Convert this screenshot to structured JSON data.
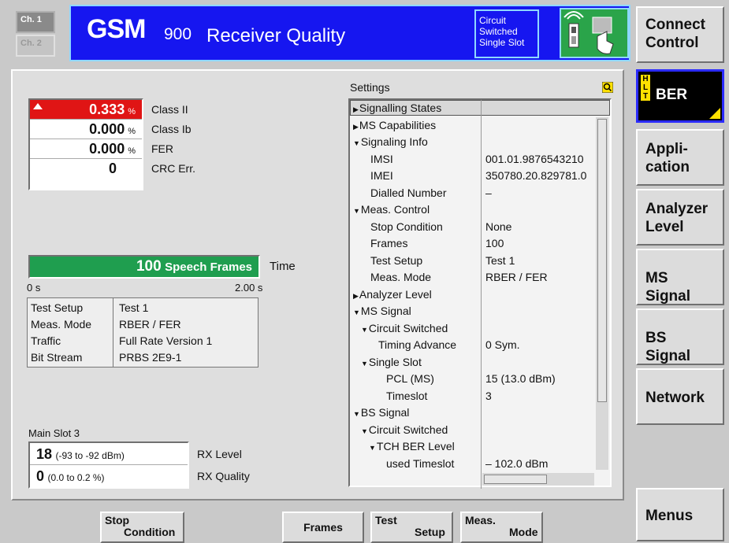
{
  "channels": [
    {
      "label": "Ch. 1",
      "active": true
    },
    {
      "label": "Ch. 2",
      "active": false
    }
  ],
  "title": {
    "gsm": "GSM",
    "band": "900",
    "measurement": "Receiver Quality"
  },
  "mode": {
    "line1": "Circuit",
    "line2": "Switched",
    "line3": "Single Slot"
  },
  "softkeys_right": {
    "connect": {
      "line1": "Connect",
      "line2": "Control"
    },
    "ber": {
      "label": "BER",
      "hlt": "HLT"
    },
    "application": {
      "line1": "Appli-",
      "line2": "cation"
    },
    "analyzer": {
      "line1": "Analyzer",
      "line2": "Level"
    },
    "ms_signal": "MS Signal",
    "bs_signal": "BS Signal",
    "network": "Network",
    "menus": "Menus"
  },
  "results": [
    {
      "value": "0.333",
      "unit": "%",
      "label": "Class II",
      "alarm": true
    },
    {
      "value": "0.000",
      "unit": "%",
      "label": "Class Ib",
      "alarm": false
    },
    {
      "value": "0.000",
      "unit": "%",
      "label": "FER",
      "alarm": false
    },
    {
      "value": "0",
      "unit": "",
      "label": "CRC Err.",
      "alarm": false
    }
  ],
  "progress": {
    "count": "100",
    "unit": "Speech Frames",
    "label": "Time",
    "start": "0 s",
    "end": "2.00 s",
    "fill_fraction": 1.0,
    "bar_color": "#1f9e4f"
  },
  "info": {
    "rows": [
      {
        "key": "Test Setup",
        "value": "Test 1"
      },
      {
        "key": "Meas. Mode",
        "value": "RBER / FER"
      },
      {
        "key": "Traffic",
        "value": "Full Rate Version 1"
      },
      {
        "key": "Bit Stream",
        "value": "PRBS 2E9-1"
      }
    ]
  },
  "slot": {
    "title": "Main Slot 3",
    "rx_level": {
      "value": "18",
      "range": "(-93  to -92  dBm)",
      "label": "RX Level"
    },
    "rx_quality": {
      "value": "0",
      "range": "(0.0  to 0.2  %)",
      "label": "RX Quality"
    }
  },
  "settings": {
    "title": "Settings",
    "rows": [
      {
        "label": "Signalling States",
        "value": "",
        "indent": 0,
        "arrow": "right"
      },
      {
        "label": "MS Capabilities",
        "value": "",
        "indent": 0,
        "arrow": "right"
      },
      {
        "label": "Signaling Info",
        "value": "",
        "indent": 0,
        "arrow": "down"
      },
      {
        "label": "IMSI",
        "value": "001.01.9876543210",
        "indent": 1,
        "arrow": ""
      },
      {
        "label": "IMEI",
        "value": "350780.20.829781.0",
        "indent": 1,
        "arrow": ""
      },
      {
        "label": "Dialled Number",
        "value": "–",
        "indent": 1,
        "arrow": ""
      },
      {
        "label": "Meas. Control",
        "value": "",
        "indent": 0,
        "arrow": "down"
      },
      {
        "label": "Stop Condition",
        "value": "None",
        "indent": 1,
        "arrow": ""
      },
      {
        "label": "Frames",
        "value": "100",
        "indent": 1,
        "arrow": ""
      },
      {
        "label": "Test Setup",
        "value": "Test 1",
        "indent": 1,
        "arrow": ""
      },
      {
        "label": "Meas. Mode",
        "value": "RBER / FER",
        "indent": 1,
        "arrow": ""
      },
      {
        "label": "Analyzer Level",
        "value": "",
        "indent": 0,
        "arrow": "right"
      },
      {
        "label": "MS Signal",
        "value": "",
        "indent": 0,
        "arrow": "down"
      },
      {
        "label": "Circuit Switched",
        "value": "",
        "indent": 1,
        "arrow": "down"
      },
      {
        "label": "Timing Advance",
        "value": "0  Sym.",
        "indent": 2,
        "arrow": ""
      },
      {
        "label": "Single Slot",
        "value": "",
        "indent": 1,
        "arrow": "down"
      },
      {
        "label": "PCL (MS)",
        "value": "15  (13.0 dBm)",
        "indent": 3,
        "arrow": ""
      },
      {
        "label": "Timeslot",
        "value": "3",
        "indent": 3,
        "arrow": ""
      },
      {
        "label": "BS Signal",
        "value": "",
        "indent": 0,
        "arrow": "down"
      },
      {
        "label": "Circuit Switched",
        "value": "",
        "indent": 1,
        "arrow": "down"
      },
      {
        "label": "TCH BER Level",
        "value": "",
        "indent": 2,
        "arrow": "down"
      },
      {
        "label": "used Timeslot",
        "value": "– 102.0  dBm",
        "indent": 3,
        "arrow": ""
      }
    ]
  },
  "bottom_keys": {
    "stop": {
      "line1": "Stop",
      "line2": "Condition"
    },
    "frames": "Frames",
    "test": {
      "line1": "Test",
      "line2": "Setup"
    },
    "meas": {
      "line1": "Meas.",
      "line2": "Mode"
    }
  },
  "colors": {
    "title_bg": "#1616f0",
    "alarm": "#e01515",
    "progress": "#1f9e4f",
    "hlt": "#ffe000"
  }
}
